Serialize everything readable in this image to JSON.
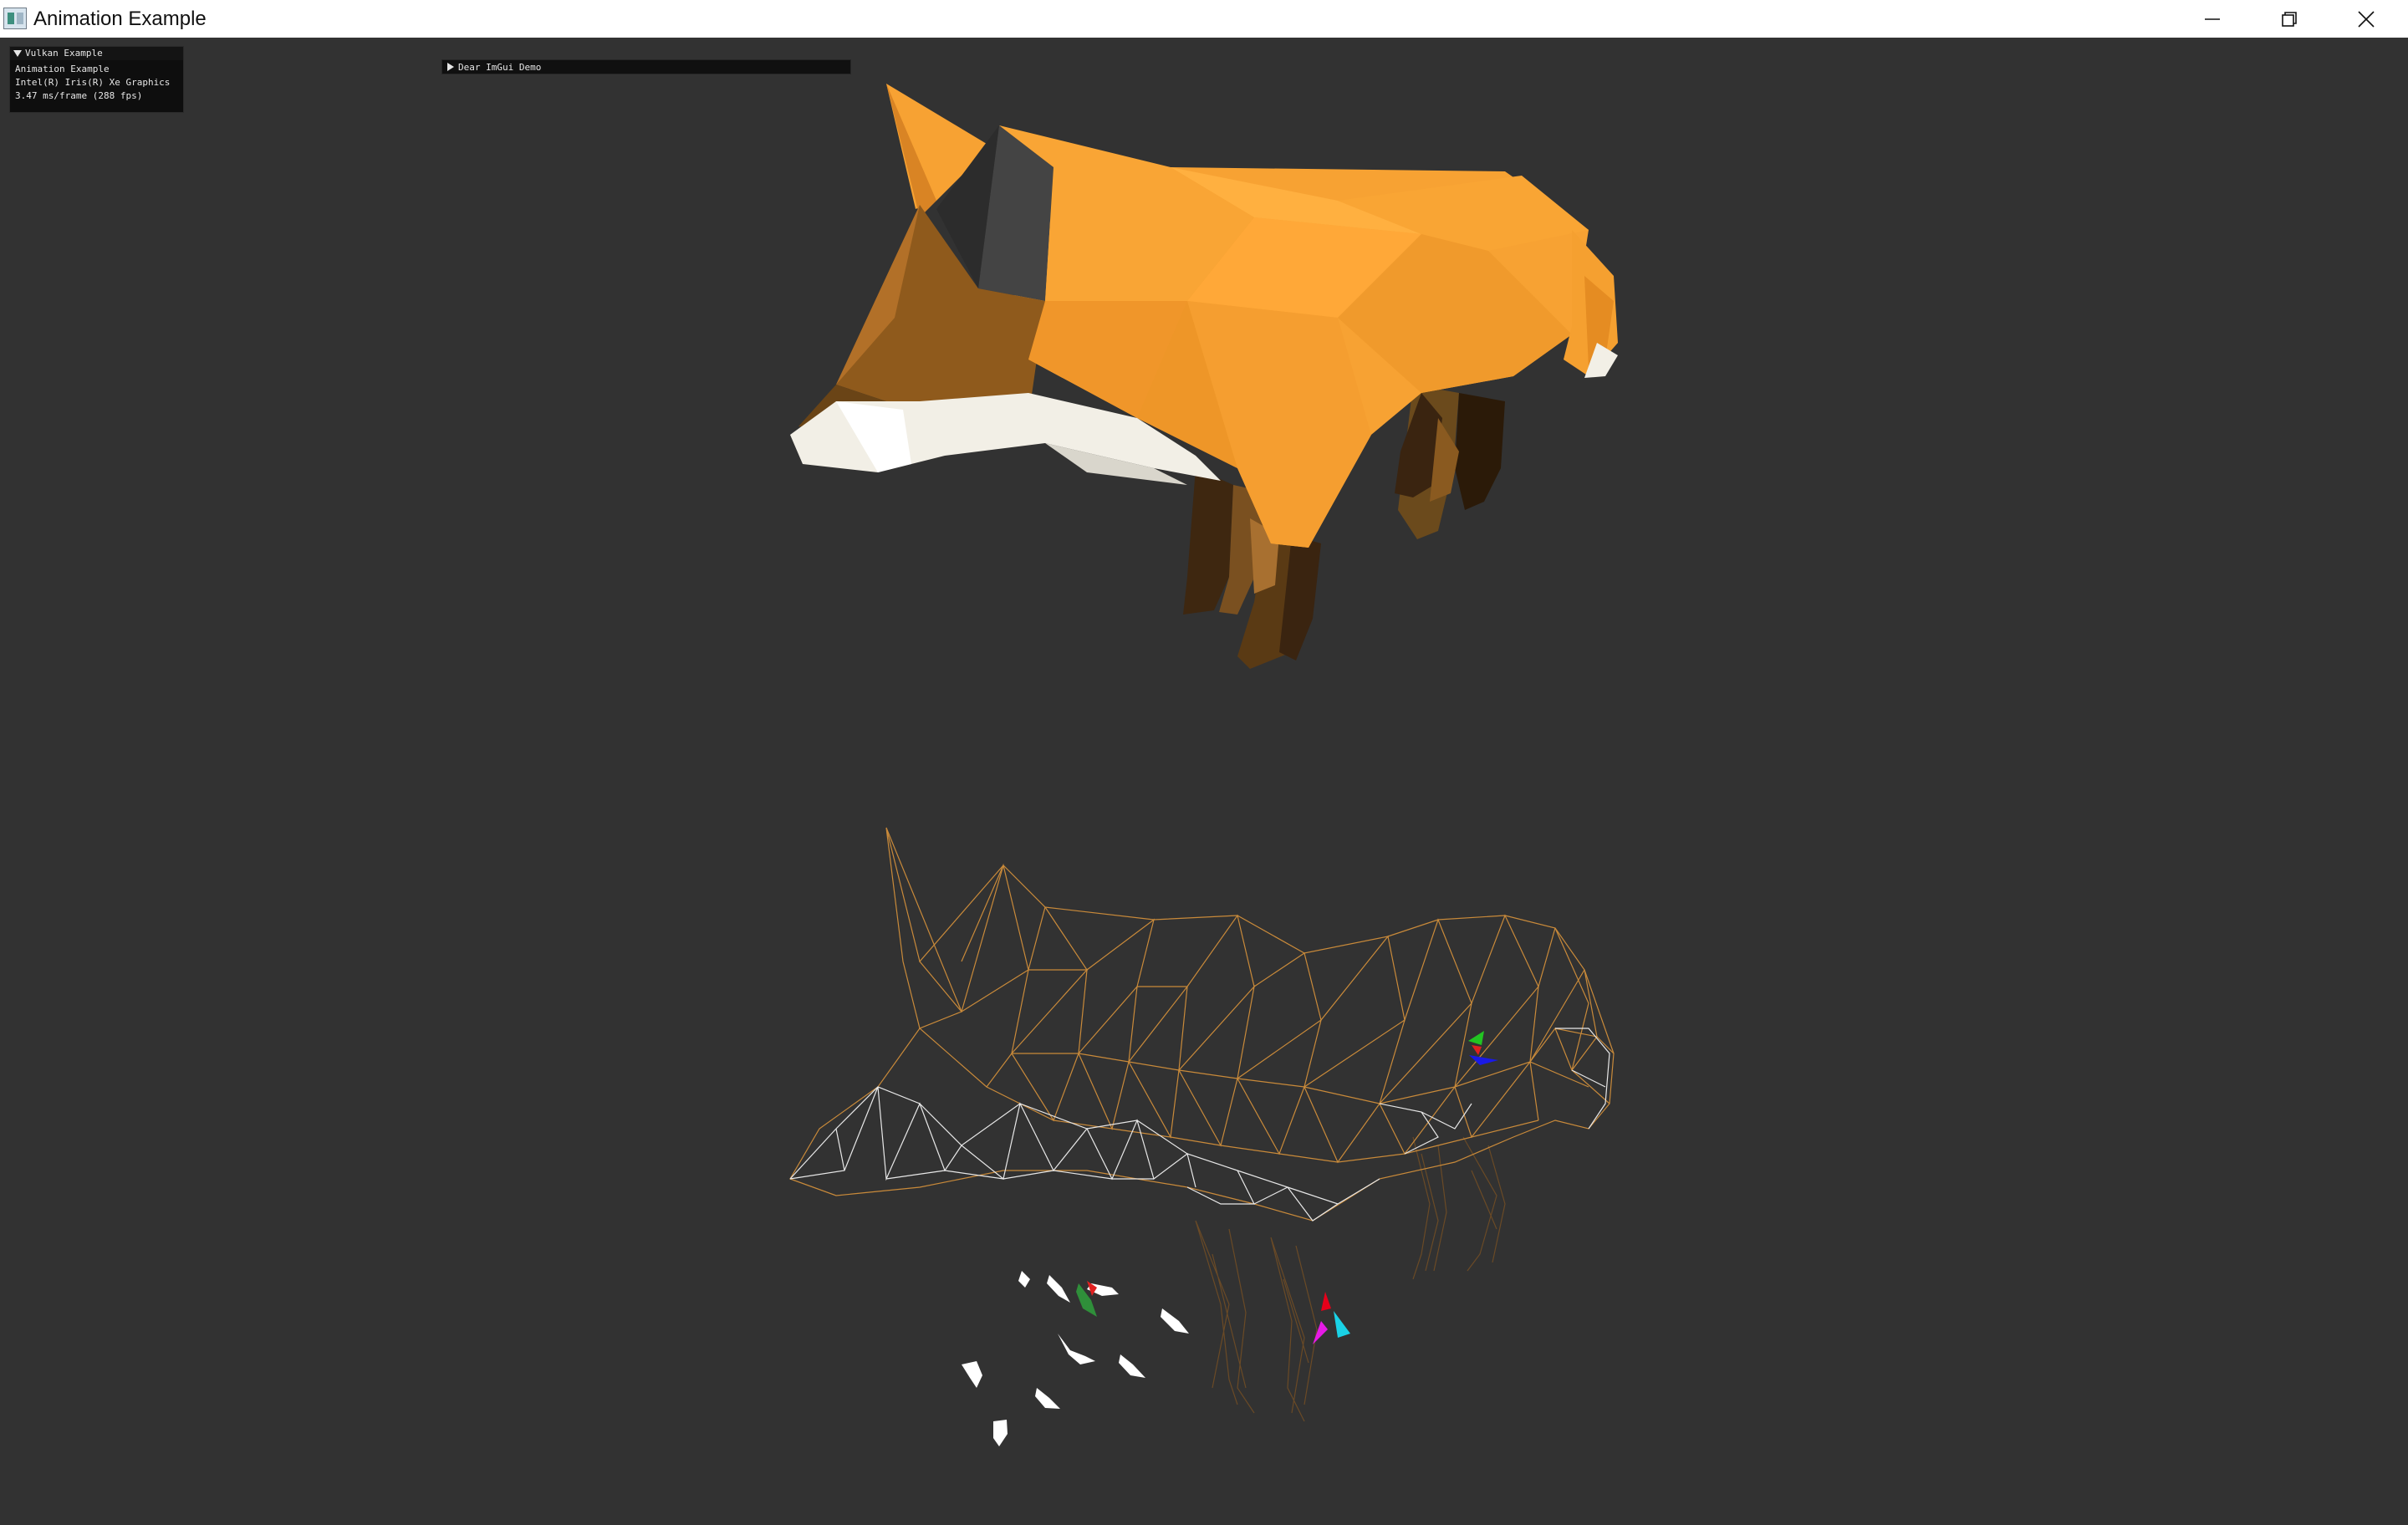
{
  "window": {
    "title": "Animation Example",
    "controls": {
      "minimize": "minimize-icon",
      "maximize": "restore-icon",
      "close": "close-icon"
    }
  },
  "overlay": {
    "header": "Vulkan Example",
    "lines": [
      "Animation Example",
      "Intel(R) Iris(R) Xe Graphics",
      "3.47 ms/frame (288 fps)"
    ]
  },
  "demo_window": {
    "label": "Dear ImGui Demo",
    "collapsed": true
  },
  "scene": {
    "background": "#323232",
    "models": [
      "solid-fox-model",
      "wireframe-fox-model"
    ],
    "colors": {
      "fox_orange": "#f5a030",
      "fox_white": "#f2efe6",
      "fox_dark": "#5a3a14",
      "wire_orange": "#c98a3a",
      "wire_white": "#e8e8e8"
    }
  }
}
